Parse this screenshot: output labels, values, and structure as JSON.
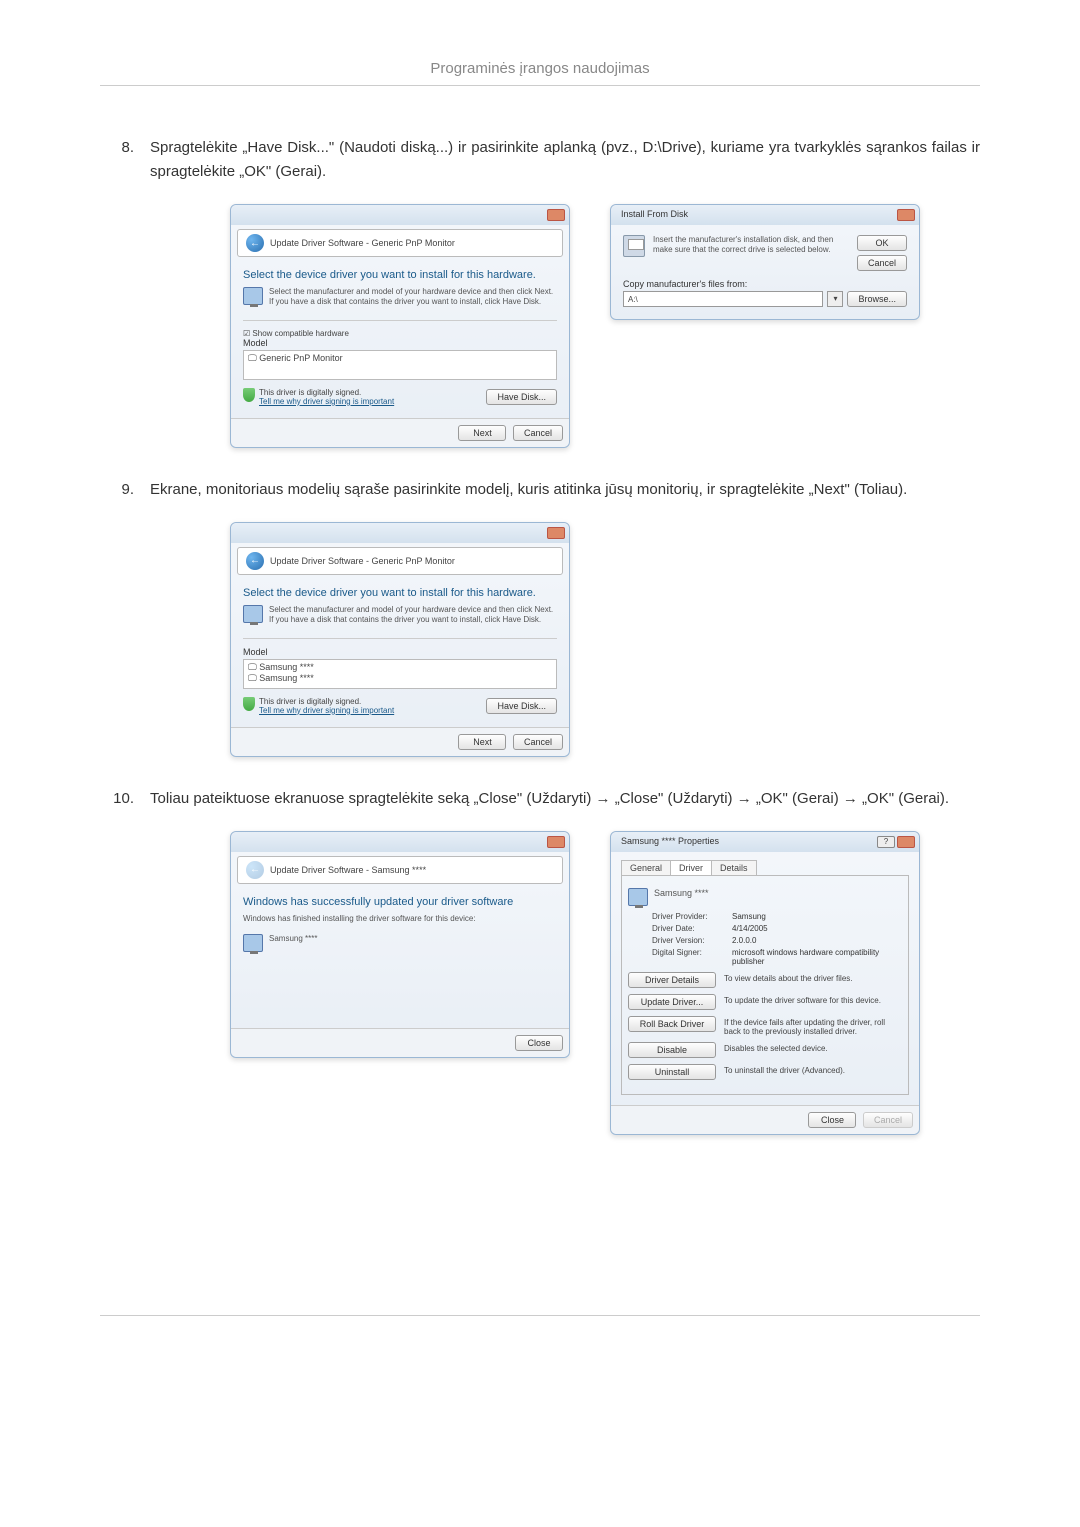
{
  "page": {
    "header": "Programinės įrangos naudojimas"
  },
  "steps": {
    "s8": {
      "num": "8.",
      "text": "Spragtelėkite „Have Disk...\" (Naudoti diską...) ir pasirinkite aplanką (pvz., D:\\Drive), kuriame yra tvarkyklės sąrankos failas ir spragtelėkite „OK\" (Gerai)."
    },
    "s9": {
      "num": "9.",
      "text": "Ekrane, monitoriaus modelių sąraše pasirinkite modelį, kuris atitinka jūsų monitorių, ir spragtelėkite „Next\" (Toliau)."
    },
    "s10": {
      "num": "10.",
      "text": "Toliau pateiktuose ekranuose spragtelėkite seką „Close\" (Uždaryti) → „Close\" (Uždaryti) → „OK\" (Gerai) → „OK\" (Gerai)."
    }
  },
  "win1a": {
    "crumb": "Update Driver Software - Generic PnP Monitor",
    "heading": "Select the device driver you want to install for this hardware.",
    "sub": "Select the manufacturer and model of your hardware device and then click Next. If you have a disk that contains the driver you want to install, click Have Disk.",
    "chk": "Show compatible hardware",
    "model_lbl": "Model",
    "model1": "Generic PnP Monitor",
    "signed": "This driver is digitally signed.",
    "tellme": "Tell me why driver signing is important",
    "havedisk": "Have Disk...",
    "next": "Next",
    "cancel": "Cancel"
  },
  "win1b": {
    "title": "Install From Disk",
    "instr": "Insert the manufacturer's installation disk, and then make sure that the correct drive is selected below.",
    "ok": "OK",
    "cancel": "Cancel",
    "copy_lbl": "Copy manufacturer's files from:",
    "drive": "A:\\",
    "browse": "Browse..."
  },
  "win2": {
    "crumb": "Update Driver Software - Generic PnP Monitor",
    "heading": "Select the device driver you want to install for this hardware.",
    "sub": "Select the manufacturer and model of your hardware device and then click Next. If you have a disk that contains the driver you want to install, click Have Disk.",
    "model_lbl": "Model",
    "model1": "Samsung ****",
    "model2": "Samsung ****",
    "signed": "This driver is digitally signed.",
    "tellme": "Tell me why driver signing is important",
    "havedisk": "Have Disk...",
    "next": "Next",
    "cancel": "Cancel"
  },
  "win3a": {
    "crumb": "Update Driver Software - Samsung ****",
    "heading": "Windows has successfully updated your driver software",
    "sub": "Windows has finished installing the driver software for this device:",
    "device": "Samsung ****",
    "close": "Close"
  },
  "win3b": {
    "title": "Samsung **** Properties",
    "tab_general": "General",
    "tab_driver": "Driver",
    "tab_details": "Details",
    "dev": "Samsung ****",
    "provider_k": "Driver Provider:",
    "provider_v": "Samsung",
    "date_k": "Driver Date:",
    "date_v": "4/14/2005",
    "ver_k": "Driver Version:",
    "ver_v": "2.0.0.0",
    "signer_k": "Digital Signer:",
    "signer_v": "microsoft windows hardware compatibility publisher",
    "b_details": "Driver Details",
    "d_details": "To view details about the driver files.",
    "b_update": "Update Driver...",
    "d_update": "To update the driver software for this device.",
    "b_roll": "Roll Back Driver",
    "d_roll": "If the device fails after updating the driver, roll back to the previously installed driver.",
    "b_disable": "Disable",
    "d_disable": "Disables the selected device.",
    "b_uninstall": "Uninstall",
    "d_uninstall": "To uninstall the driver (Advanced).",
    "close": "Close",
    "cancel": "Cancel"
  }
}
